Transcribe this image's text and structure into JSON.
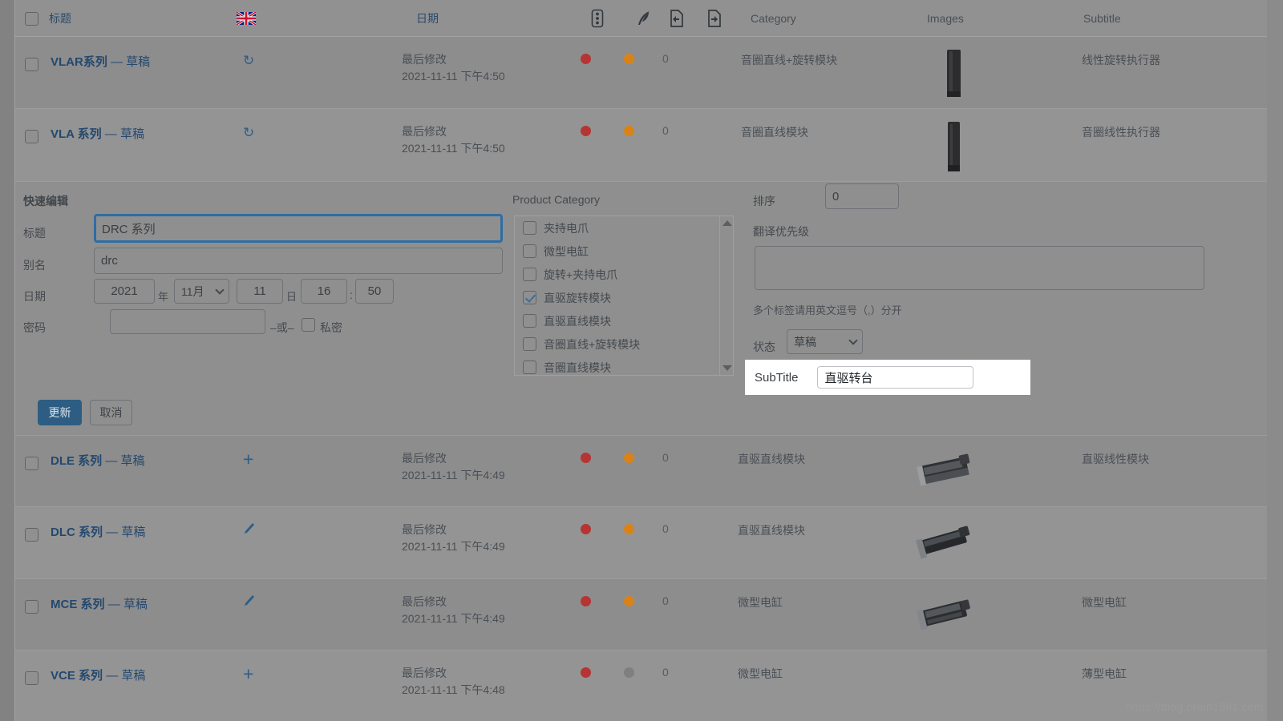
{
  "colors": {
    "link": "#24486e",
    "primary_button": "#2d5d82",
    "dot_red": "#b63434",
    "dot_orange": "#d98317",
    "dot_gray": "#7f7f7f",
    "page_bg": "#8d8d8d",
    "popup_bg": "#ffffff"
  },
  "header": {
    "select_all": "select-all-checkbox",
    "title": "标题",
    "flag_icon": "uk-flag-icon",
    "date": "日期",
    "traffic_icon": "traffic-light-icon",
    "feather_icon": "feather-icon",
    "import_icon": "document-import-icon",
    "export_icon": "document-export-icon",
    "category": "Category",
    "images": "Images",
    "subtitle": "Subtitle"
  },
  "rows": [
    {
      "title_code": "VLAR系列",
      "title_suffix": "— 草稿",
      "action_icon": "sync-icon",
      "date_label": "最后修改",
      "date_value": "2021-11-11 下午4:50",
      "dot1": "#b63434",
      "dot2": "#d98317",
      "count": "0",
      "category": "音圈直线+旋转模块",
      "image": "product-thumb-dark-bar",
      "subtitle": "线性旋转执行器"
    },
    {
      "title_code": "VLA 系列",
      "title_suffix": "— 草稿",
      "action_icon": "sync-icon",
      "date_label": "最后修改",
      "date_value": "2021-11-11 下午4:50",
      "dot1": "#b63434",
      "dot2": "#d98317",
      "count": "0",
      "category": "音圈直线模块",
      "image": "product-thumb-dark-bar",
      "subtitle": "音圈线性执行器"
    }
  ],
  "rows_below": [
    {
      "title_code": "DLE 系列",
      "title_suffix": "— 草稿",
      "action_icon": "plus-icon",
      "date_label": "最后修改",
      "date_value": "2021-11-11 下午4:49",
      "dot1": "#b63434",
      "dot2": "#d98317",
      "count": "0",
      "category": "直驱直线模块",
      "image": "product-thumb-stage",
      "subtitle": "直驱线性模块"
    },
    {
      "title_code": "DLC 系列",
      "title_suffix": "— 草稿",
      "action_icon": "pencil-icon",
      "date_label": "最后修改",
      "date_value": "2021-11-11 下午4:49",
      "dot1": "#b63434",
      "dot2": "#d98317",
      "count": "0",
      "category": "直驱直线模块",
      "image": "product-thumb-stage",
      "subtitle": ""
    },
    {
      "title_code": "MCE 系列",
      "title_suffix": "— 草稿",
      "action_icon": "pencil-icon",
      "date_label": "最后修改",
      "date_value": "2021-11-11 下午4:49",
      "dot1": "#b63434",
      "dot2": "#d98317",
      "count": "0",
      "category": "微型电缸",
      "image": "product-thumb-cylinder",
      "subtitle": "微型电缸"
    },
    {
      "title_code": "VCE 系列",
      "title_suffix": "— 草稿",
      "action_icon": "plus-icon",
      "date_label": "最后修改",
      "date_value": "2021-11-11 下午4:48",
      "dot1": "#b63434",
      "dot2": "#7f7f7f",
      "count": "0",
      "category": "微型电缸",
      "image": "",
      "subtitle": "薄型电缸"
    }
  ],
  "quick_edit": {
    "heading": "快速编辑",
    "title_label": "标题",
    "title_value": "DRC 系列",
    "slug_label": "别名",
    "slug_value": "drc",
    "date_label": "日期",
    "year_value": "2021",
    "year_unit": "年",
    "month_value": "11月",
    "day_value": "11",
    "day_unit": "日",
    "hour_value": "16",
    "time_sep": ":",
    "minute_value": "50",
    "password_label": "密码",
    "password_value": "",
    "or_text": "–或–",
    "private_label": "私密",
    "update_button": "更新",
    "cancel_button": "取消"
  },
  "product_category": {
    "heading": "Product Category",
    "items": [
      {
        "label": "夹持电爪",
        "checked": false
      },
      {
        "label": "微型电缸",
        "checked": false
      },
      {
        "label": "旋转+夹持电爪",
        "checked": false
      },
      {
        "label": "直驱旋转模块",
        "checked": true
      },
      {
        "label": "直驱直线模块",
        "checked": false
      },
      {
        "label": "音圈直线+旋转模块",
        "checked": false
      },
      {
        "label": "音圈直线模块",
        "checked": false
      }
    ]
  },
  "right_panel": {
    "order_label": "排序",
    "order_value": "0",
    "priority_label": "翻译优先级",
    "priority_value": "",
    "priority_hint": "多个标签请用英文逗号（,）分开",
    "status_label": "状态",
    "status_value": "草稿"
  },
  "subtitle_popup": {
    "label": "SubTitle",
    "value": "直驱转台"
  },
  "watermark": "https://blog.brain1981.com"
}
